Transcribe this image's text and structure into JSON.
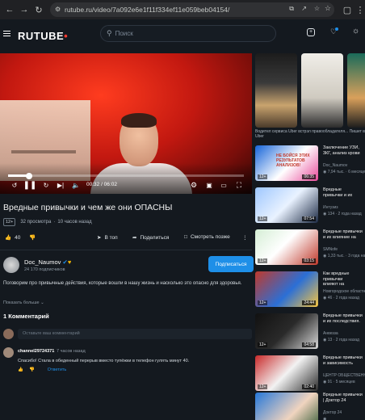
{
  "browser": {
    "url": "rutube.ru/video/7a092e6e1f11f334ef11e059beb04154/"
  },
  "header": {
    "logo": "RUTUBE",
    "search_placeholder": "Поиск"
  },
  "player": {
    "timecode": "00:32 / 06:02",
    "progress": 0.088
  },
  "video": {
    "title": "Вредные привычки и чем же они ОПАСНЫ",
    "age_rating": "12+",
    "views": "32 просмотра",
    "published": "10 часов назад",
    "likes": "40",
    "actions": {
      "in_feed": "В топ",
      "share": "Поделиться",
      "watch_later": "Смотреть позже"
    }
  },
  "channel": {
    "name": "Doc_Naumov",
    "subscribers": "24 170 подписчиков",
    "subscribe_label": "Подписаться"
  },
  "description": "Поговорим про привычные действия, которые вошли в нашу жизнь и насколько это опасно для здоровья.",
  "show_more": "Показать больше",
  "comments": {
    "title": "1 Комментарий",
    "placeholder": "Оставьте ваш комментарий",
    "items": [
      {
        "user": "channel29724371",
        "time": "7 часов назад",
        "text": "Спасибо! Стала в обеденный перерыв вместо тупёжки в телефон гулять минут 40.",
        "reply": "Ответить"
      }
    ]
  },
  "sidebar": {
    "shorts_caption": "Водител сервиса Uber встрэл правообладателя... Пишет в Uber",
    "recommendations": [
      {
        "title": "Заключение УЗИ,\n3КГ, анализ крови",
        "channel": "Doc_Naumov",
        "stats": "7,94 тыс. · 6 месяцев",
        "age": "12+",
        "duration": "06:35",
        "thumb_text": "НЕ БОЙСЯ ЭТИХ РЕЗУЛЬТАТОВ АНАЛИЗОВ!"
      },
      {
        "title": "Вредные\nпривычки и их",
        "channel": "Интузиз",
        "stats": "134 · 2 года назад",
        "age": "12+",
        "duration": "07:54",
        "thumb_text": ""
      },
      {
        "title": "Вредные привычки\nи их влияние на",
        "channel": "SMNofe",
        "stats": "1,33 тыс. · 3 года назад",
        "age": "12+",
        "duration": "03:15",
        "thumb_text": ""
      },
      {
        "title": "Как вредные\nпривычки\nвлияют на",
        "channel": "Новгородское областн.",
        "stats": "46 · 2 года назад",
        "age": "12+",
        "duration": "24:44",
        "thumb_text": ""
      },
      {
        "title": "Вредные привычки\nи их последствия.",
        "channel": "Анвезза",
        "stats": "13 · 2 года назад",
        "age": "12+",
        "duration": "04:58",
        "thumb_text": ""
      },
      {
        "title": "Вредные привычки\nи зависимость",
        "channel": "ЦЕНТР ОБЩЕСТВЕННО",
        "stats": "91 · 5 месяцев",
        "age": "12+",
        "duration": "02:40",
        "thumb_text": ""
      },
      {
        "title": "Вредные привычки\n| Доктор 24",
        "channel": "Доктор 24",
        "stats": "",
        "age": "",
        "duration": "",
        "thumb_text": ""
      }
    ]
  }
}
